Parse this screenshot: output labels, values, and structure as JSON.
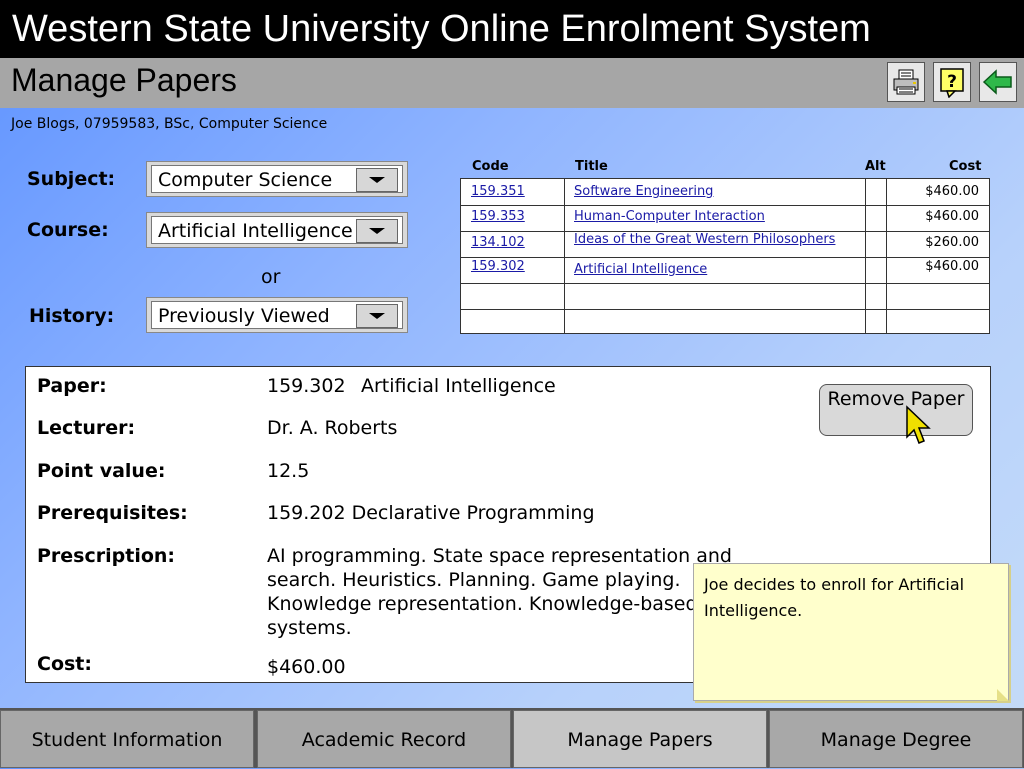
{
  "header": {
    "app_title": "Western State University Online Enrolment System",
    "page_title": "Manage Papers"
  },
  "toolbar": {
    "buttons": [
      {
        "name": "print",
        "icon": "printer-icon"
      },
      {
        "name": "help",
        "icon": "help-icon"
      },
      {
        "name": "back",
        "icon": "back-arrow-icon"
      }
    ]
  },
  "user_info": "Joe Blogs, 07959583, BSc, Computer Science",
  "filters": {
    "subject_label": "Subject:",
    "subject_value": "Computer Science",
    "course_label": "Course:",
    "course_value": "Artificial Intelligence",
    "or_text": "or",
    "history_label": "History:",
    "history_value": "Previously Viewed"
  },
  "papers_table": {
    "headers": {
      "code": "Code",
      "title": "Title",
      "alt": "Alt",
      "cost": "Cost"
    },
    "rows": [
      {
        "code": "159.351",
        "title": "Software Engineering",
        "alt": "",
        "cost": "$460.00"
      },
      {
        "code": "159.353",
        "title": "Human-Computer Interaction",
        "alt": "",
        "cost": "$460.00"
      },
      {
        "code": "134.102",
        "title": "Ideas of the Great Western Philosophers",
        "alt": "",
        "cost": "$260.00"
      },
      {
        "code": "159.302",
        "title": "Artificial Intelligence",
        "alt": "",
        "cost": "$460.00"
      },
      {
        "code": "",
        "title": "",
        "alt": "",
        "cost": ""
      },
      {
        "code": "",
        "title": "",
        "alt": "",
        "cost": ""
      }
    ]
  },
  "paper_detail": {
    "paper_label": "Paper:",
    "paper_code": "159.302",
    "paper_title": "Artificial Intelligence",
    "lecturer_label": "Lecturer:",
    "lecturer": "Dr. A. Roberts",
    "points_label": "Point value:",
    "points": "12.5",
    "prereq_label": "Prerequisites:",
    "prereq": "159.202 Declarative Programming",
    "prescription_label": "Prescription:",
    "prescription": "AI programming. State space representation and search. Heuristics. Planning. Game playing. Knowledge representation. Knowledge-based systems.",
    "cost_label": "Cost:",
    "cost": "$460.00",
    "remove_button": "Remove Paper"
  },
  "note": "Joe decides to enroll for Artificial Intelligence.",
  "nav": {
    "tabs": [
      "Student Information",
      "Academic Record",
      "Manage Papers",
      "Manage Degree"
    ],
    "active": "Manage Papers"
  },
  "colors": {
    "title_bar": "#000000",
    "sub_bar": "#a6a6a6",
    "link": "#1a1aa6",
    "note_bg": "#ffffcc"
  }
}
